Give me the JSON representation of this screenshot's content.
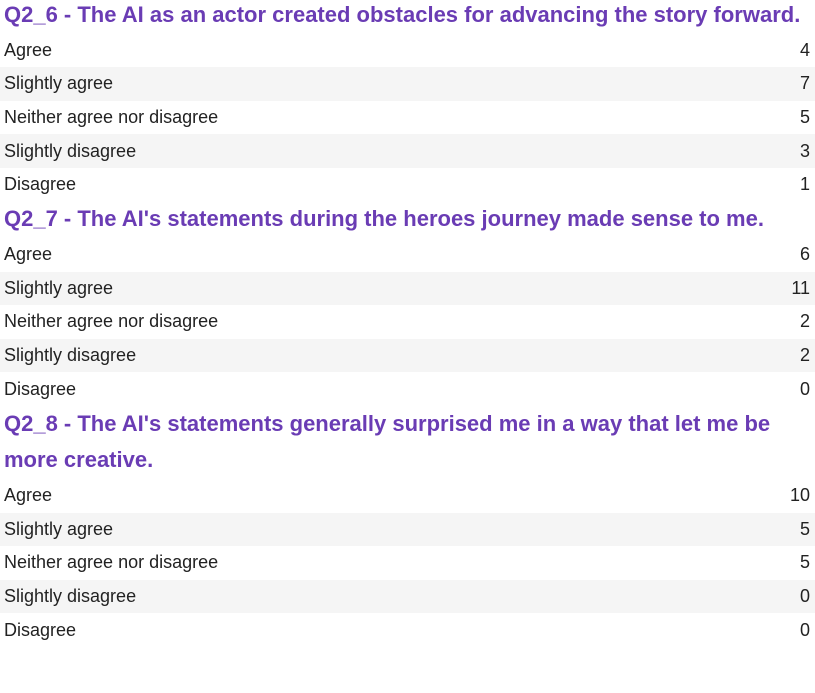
{
  "questions": [
    {
      "title": "Q2_6 - The AI as an actor created obstacles for advancing the story forward.",
      "rows": [
        {
          "label": "Agree",
          "count": "4"
        },
        {
          "label": "Slightly agree",
          "count": "7"
        },
        {
          "label": "Neither agree nor disagree",
          "count": "5"
        },
        {
          "label": "Slightly disagree",
          "count": "3"
        },
        {
          "label": "Disagree",
          "count": "1"
        }
      ]
    },
    {
      "title": "Q2_7 - The AI's statements during the heroes journey made sense to me.",
      "rows": [
        {
          "label": "Agree",
          "count": "6"
        },
        {
          "label": "Slightly agree",
          "count": "11"
        },
        {
          "label": "Neither agree nor disagree",
          "count": "2"
        },
        {
          "label": "Slightly disagree",
          "count": "2"
        },
        {
          "label": "Disagree",
          "count": "0"
        }
      ]
    },
    {
      "title": "Q2_8 - The AI's statements generally surprised me in a way that let me be more creative.",
      "rows": [
        {
          "label": "Agree",
          "count": "10"
        },
        {
          "label": "Slightly agree",
          "count": "5"
        },
        {
          "label": "Neither agree nor disagree",
          "count": "5"
        },
        {
          "label": "Slightly disagree",
          "count": "0"
        },
        {
          "label": "Disagree",
          "count": "0"
        }
      ]
    }
  ]
}
